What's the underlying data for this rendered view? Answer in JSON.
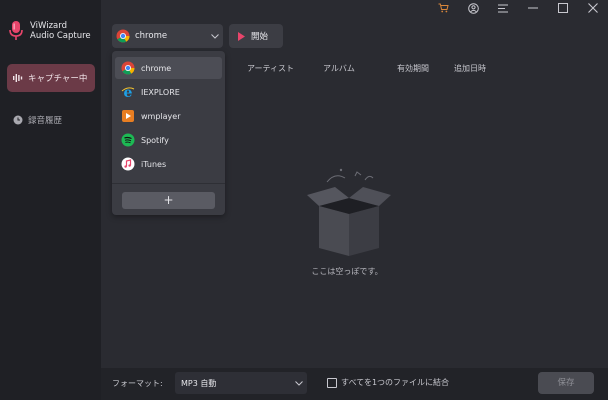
{
  "app": {
    "title_line1": "ViWizard",
    "title_line2": "Audio Capture",
    "logo_icon": "microphone-icon"
  },
  "sidebar": {
    "items": [
      {
        "label": "キャプチャー中",
        "icon": "waveform-icon",
        "active": true
      },
      {
        "label": "録音履歴",
        "icon": "clock-icon",
        "active": false
      }
    ]
  },
  "titlebar": {
    "icons": [
      "cart-icon",
      "user-icon",
      "menu-icon",
      "minimize-icon",
      "maximize-icon",
      "close-icon"
    ]
  },
  "toolbar": {
    "browser_value": "chrome",
    "start_label": "開始"
  },
  "table": {
    "columns": [
      "アーティスト",
      "アルバム",
      "有効期間",
      "追加日時"
    ]
  },
  "dropdown": {
    "items": [
      {
        "label": "chrome",
        "icon": "chrome-icon",
        "selected": true
      },
      {
        "label": "IEXPLORE",
        "icon": "ie-icon",
        "selected": false
      },
      {
        "label": "wmplayer",
        "icon": "wmplayer-icon",
        "selected": false
      },
      {
        "label": "Spotify",
        "icon": "spotify-icon",
        "selected": false
      },
      {
        "label": "iTunes",
        "icon": "itunes-icon",
        "selected": false
      }
    ],
    "add_label": "+"
  },
  "empty_state": {
    "text": "ここは空っぽです。",
    "icon": "empty-box-icon"
  },
  "bottom": {
    "format_label": "フォーマット:",
    "format_value": "MP3 自動",
    "merge_label": "すべてを1つのファイルに結合",
    "save_label": "保存"
  },
  "colors": {
    "accent": "#e8456b",
    "sidebar_bg": "#1f2025",
    "main_bg": "#2a2b31",
    "active_nav": "#6b3a47",
    "cart": "#d9863a"
  }
}
